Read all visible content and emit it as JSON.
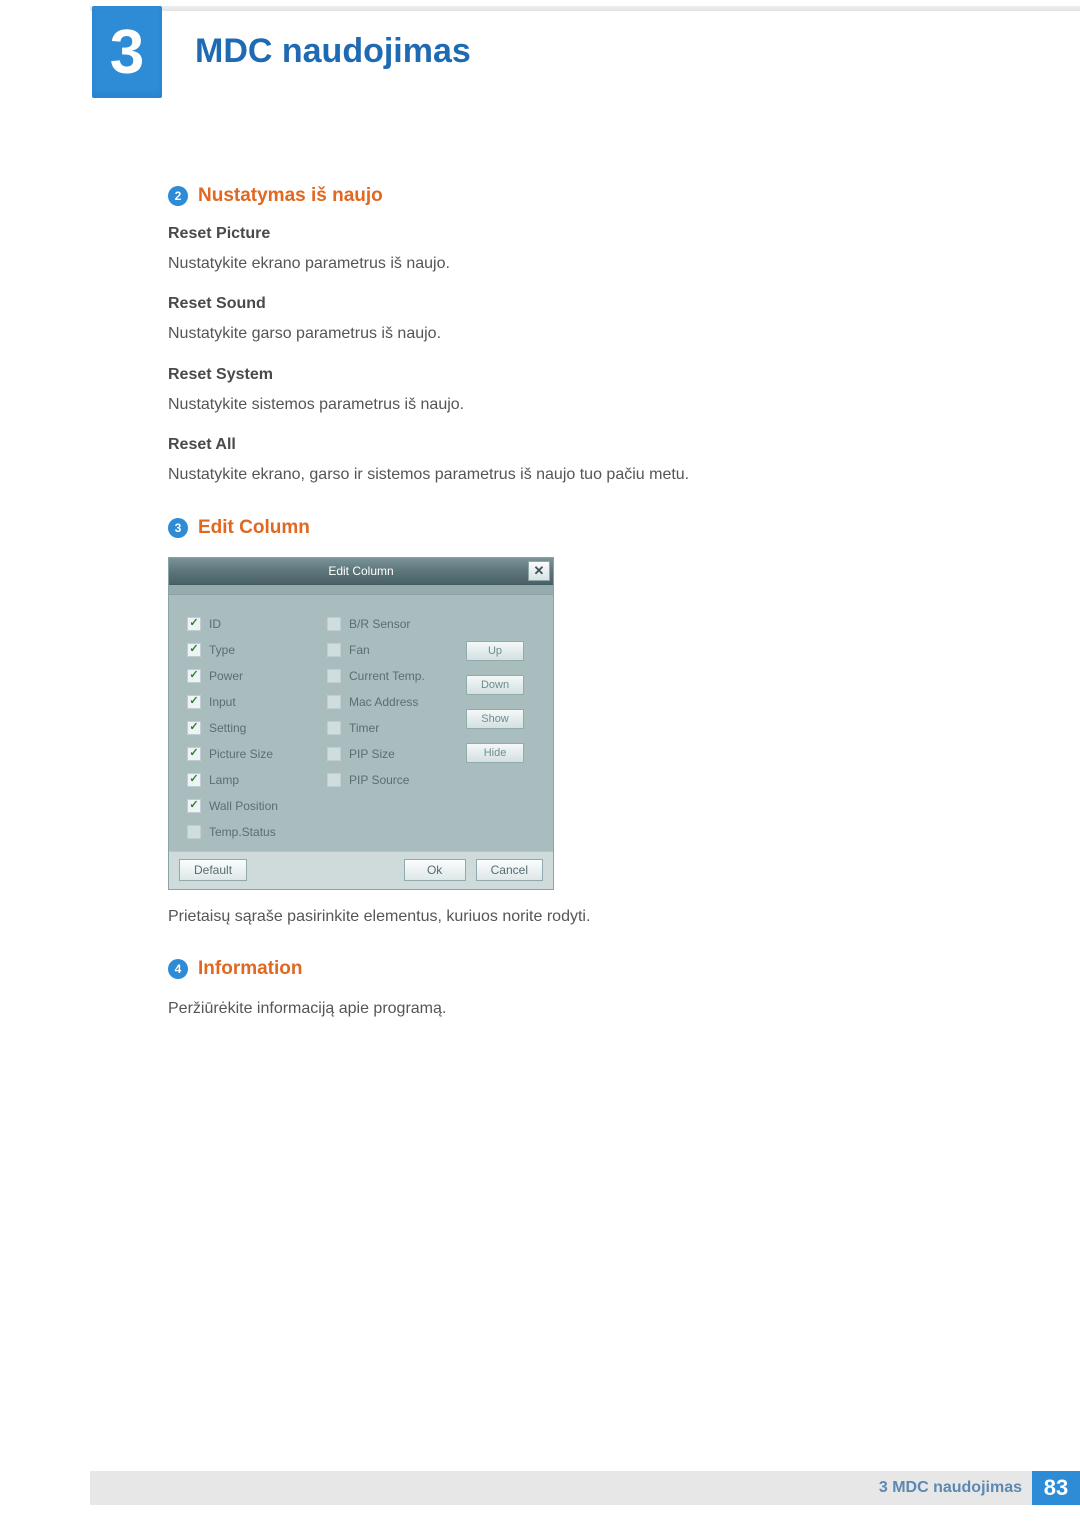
{
  "chapter": {
    "number": "3",
    "title": "MDC naudojimas"
  },
  "sections": {
    "s2": {
      "num": "2",
      "title": "Nustatymas iš naujo",
      "items": {
        "reset_picture": {
          "head": "Reset Picture",
          "body": "Nustatykite ekrano parametrus iš naujo."
        },
        "reset_sound": {
          "head": "Reset Sound",
          "body": "Nustatykite garso parametrus iš naujo."
        },
        "reset_system": {
          "head": "Reset System",
          "body": "Nustatykite sistemos parametrus iš naujo."
        },
        "reset_all": {
          "head": "Reset All",
          "body": "Nustatykite ekrano, garso ir sistemos parametrus iš naujo tuo pačiu metu."
        }
      }
    },
    "s3": {
      "num": "3",
      "title": "Edit Column",
      "dialog": {
        "title": "Edit Column",
        "left": [
          {
            "label": "ID",
            "checked": true
          },
          {
            "label": "Type",
            "checked": true
          },
          {
            "label": "Power",
            "checked": true
          },
          {
            "label": "Input",
            "checked": true
          },
          {
            "label": "Setting",
            "checked": true
          },
          {
            "label": "Picture Size",
            "checked": true
          },
          {
            "label": "Lamp",
            "checked": true
          },
          {
            "label": "Wall Position",
            "checked": true
          },
          {
            "label": "Temp.Status",
            "checked": false
          }
        ],
        "right": [
          {
            "label": "B/R Sensor",
            "checked": false
          },
          {
            "label": "Fan",
            "checked": false
          },
          {
            "label": "Current Temp.",
            "checked": false
          },
          {
            "label": "Mac Address",
            "checked": false
          },
          {
            "label": "Timer",
            "checked": false
          },
          {
            "label": "PIP Size",
            "checked": false
          },
          {
            "label": "PIP Source",
            "checked": false
          }
        ],
        "side": {
          "up": "Up",
          "down": "Down",
          "show": "Show",
          "hide": "Hide"
        },
        "footer": {
          "default": "Default",
          "ok": "Ok",
          "cancel": "Cancel"
        }
      },
      "caption": "Prietaisų sąraše pasirinkite elementus, kuriuos norite rodyti."
    },
    "s4": {
      "num": "4",
      "title": "Information",
      "body": "Peržiūrėkite informaciją apie programą."
    }
  },
  "footer": {
    "label_prefix": "3",
    "label_text": "MDC naudojimas",
    "page": "83"
  }
}
